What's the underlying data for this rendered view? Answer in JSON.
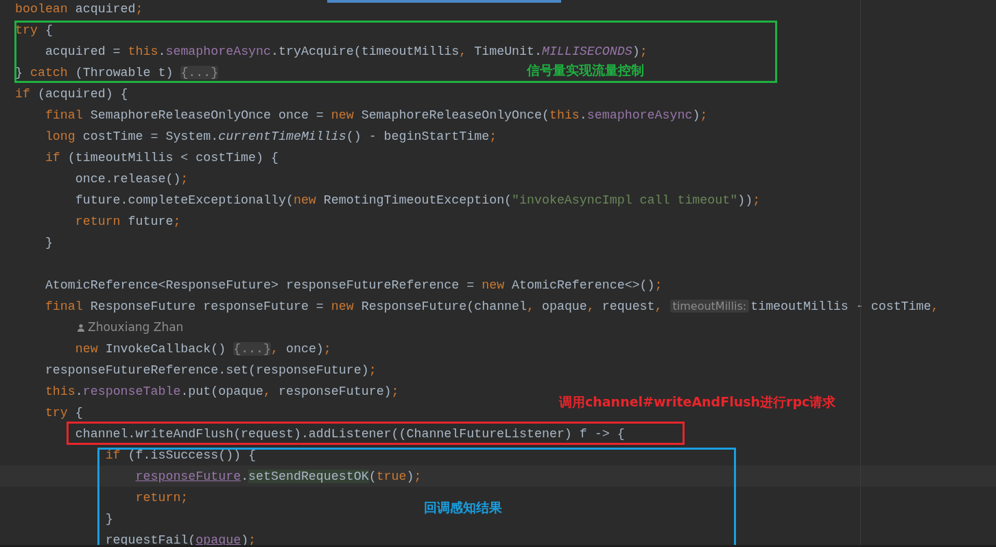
{
  "editor": {
    "lines": [
      {
        "kind": "code",
        "tokens": [
          {
            "kind": "k",
            "text": "boolean"
          },
          {
            "kind": "p",
            "text": " acquired"
          },
          {
            "kind": "k",
            "text": ";"
          }
        ]
      },
      {
        "kind": "code",
        "tokens": [
          {
            "kind": "k",
            "text": "try"
          },
          {
            "kind": "p",
            "text": " {"
          }
        ]
      },
      {
        "kind": "code",
        "tokens": [
          {
            "kind": "p",
            "text": "    acquired = "
          },
          {
            "kind": "k",
            "text": "this"
          },
          {
            "kind": "p",
            "text": "."
          },
          {
            "kind": "f",
            "text": "semaphoreAsync"
          },
          {
            "kind": "p",
            "text": ".tryAcquire(timeoutMillis"
          },
          {
            "kind": "k",
            "text": ","
          },
          {
            "kind": "p",
            "text": " TimeUnit."
          },
          {
            "kind": "c",
            "text": "MILLISECONDS"
          },
          {
            "kind": "p",
            "text": ")"
          },
          {
            "kind": "k",
            "text": ";"
          }
        ]
      },
      {
        "kind": "code",
        "tokens": [
          {
            "kind": "p",
            "text": "} "
          },
          {
            "kind": "k",
            "text": "catch"
          },
          {
            "kind": "p",
            "text": " (Throwable t) "
          },
          {
            "kind": "fold",
            "text": "{...}"
          }
        ]
      },
      {
        "kind": "code",
        "tokens": [
          {
            "kind": "k",
            "text": "if"
          },
          {
            "kind": "p",
            "text": " (acquired) {"
          }
        ]
      },
      {
        "kind": "code",
        "tokens": [
          {
            "kind": "k",
            "text": "    final"
          },
          {
            "kind": "p",
            "text": " SemaphoreReleaseOnlyOnce once = "
          },
          {
            "kind": "k",
            "text": "new"
          },
          {
            "kind": "p",
            "text": " SemaphoreReleaseOnlyOnce("
          },
          {
            "kind": "k",
            "text": "this"
          },
          {
            "kind": "p",
            "text": "."
          },
          {
            "kind": "f",
            "text": "semaphoreAsync"
          },
          {
            "kind": "p",
            "text": ")"
          },
          {
            "kind": "k",
            "text": ";"
          }
        ]
      },
      {
        "kind": "code",
        "tokens": [
          {
            "kind": "k",
            "text": "    long"
          },
          {
            "kind": "p",
            "text": " costTime = System."
          },
          {
            "kind": "i",
            "text": "currentTimeMillis"
          },
          {
            "kind": "p",
            "text": "() - beginStartTime"
          },
          {
            "kind": "k",
            "text": ";"
          }
        ]
      },
      {
        "kind": "code",
        "tokens": [
          {
            "kind": "k",
            "text": "    if"
          },
          {
            "kind": "p",
            "text": " (timeoutMillis < costTime) {"
          }
        ]
      },
      {
        "kind": "code",
        "tokens": [
          {
            "kind": "p",
            "text": "        once.release()"
          },
          {
            "kind": "k",
            "text": ";"
          }
        ]
      },
      {
        "kind": "code",
        "tokens": [
          {
            "kind": "p",
            "text": "        future.completeExceptionally("
          },
          {
            "kind": "k",
            "text": "new"
          },
          {
            "kind": "p",
            "text": " RemotingTimeoutException("
          },
          {
            "kind": "s",
            "text": "\"invokeAsyncImpl call timeout\""
          },
          {
            "kind": "p",
            "text": "))"
          },
          {
            "kind": "k",
            "text": ";"
          }
        ]
      },
      {
        "kind": "code",
        "tokens": [
          {
            "kind": "k",
            "text": "        return"
          },
          {
            "kind": "p",
            "text": " future"
          },
          {
            "kind": "k",
            "text": ";"
          }
        ]
      },
      {
        "kind": "code",
        "tokens": [
          {
            "kind": "p",
            "text": "    }"
          }
        ]
      },
      {
        "kind": "blank"
      },
      {
        "kind": "code",
        "tokens": [
          {
            "kind": "p",
            "text": "    AtomicReference<ResponseFuture> responseFutureReference = "
          },
          {
            "kind": "k",
            "text": "new"
          },
          {
            "kind": "p",
            "text": " AtomicReference<>()"
          },
          {
            "kind": "k",
            "text": ";"
          }
        ]
      },
      {
        "kind": "code",
        "tokens": [
          {
            "kind": "k",
            "text": "    final"
          },
          {
            "kind": "p",
            "text": " ResponseFuture responseFuture = "
          },
          {
            "kind": "k",
            "text": "new"
          },
          {
            "kind": "p",
            "text": " ResponseFuture(channel"
          },
          {
            "kind": "k",
            "text": ","
          },
          {
            "kind": "p",
            "text": " opaque"
          },
          {
            "kind": "k",
            "text": ","
          },
          {
            "kind": "p",
            "text": " request"
          },
          {
            "kind": "k",
            "text": ", "
          },
          {
            "kind": "hint",
            "text": "timeoutMillis:"
          },
          {
            "kind": "p",
            "text": "timeoutMillis - costTime"
          },
          {
            "kind": "k",
            "text": ","
          }
        ]
      },
      {
        "kind": "author",
        "text": "Zhouxiang Zhan"
      },
      {
        "kind": "code",
        "tokens": [
          {
            "kind": "k",
            "text": "        new"
          },
          {
            "kind": "p",
            "text": " InvokeCallback() "
          },
          {
            "kind": "fold",
            "text": "{...}"
          },
          {
            "kind": "k",
            "text": ","
          },
          {
            "kind": "p",
            "text": " once)"
          },
          {
            "kind": "k",
            "text": ";"
          }
        ]
      },
      {
        "kind": "code",
        "tokens": [
          {
            "kind": "p",
            "text": "    responseFutureReference.set(responseFuture)"
          },
          {
            "kind": "k",
            "text": ";"
          }
        ]
      },
      {
        "kind": "code",
        "tokens": [
          {
            "kind": "k",
            "text": "    this"
          },
          {
            "kind": "p",
            "text": "."
          },
          {
            "kind": "f",
            "text": "responseTable"
          },
          {
            "kind": "p",
            "text": ".put(opaque"
          },
          {
            "kind": "k",
            "text": ","
          },
          {
            "kind": "p",
            "text": " responseFuture)"
          },
          {
            "kind": "k",
            "text": ";"
          }
        ]
      },
      {
        "kind": "code",
        "tokens": [
          {
            "kind": "k",
            "text": "    try"
          },
          {
            "kind": "p",
            "text": " {"
          }
        ]
      },
      {
        "kind": "code",
        "tokens": [
          {
            "kind": "p",
            "text": "        channel.writeAndFlush(request).addListener((ChannelFutureListener) f -> {"
          }
        ]
      },
      {
        "kind": "code",
        "tokens": [
          {
            "kind": "k",
            "text": "            if"
          },
          {
            "kind": "p",
            "text": " (f.isSuccess()) {"
          }
        ]
      },
      {
        "kind": "code",
        "current": true,
        "tokens": [
          {
            "kind": "u",
            "text": "                responseFuture"
          },
          {
            "kind": "p",
            "text": "."
          },
          {
            "kind": "hl",
            "text": "setSendRequestOK"
          },
          {
            "kind": "p",
            "text": "("
          },
          {
            "kind": "k",
            "text": "true"
          },
          {
            "kind": "p",
            "text": ")"
          },
          {
            "kind": "k",
            "text": ";"
          }
        ]
      },
      {
        "kind": "code",
        "tokens": [
          {
            "kind": "k",
            "text": "                return"
          },
          {
            "kind": "k",
            "text": ";"
          }
        ]
      },
      {
        "kind": "code",
        "tokens": [
          {
            "kind": "p",
            "text": "            }"
          }
        ]
      },
      {
        "kind": "code",
        "tokens": [
          {
            "kind": "p",
            "text": "            requestFail("
          },
          {
            "kind": "u",
            "text": "opaque"
          },
          {
            "kind": "p",
            "text": ")"
          },
          {
            "kind": "k",
            "text": ";"
          }
        ]
      }
    ]
  },
  "annotations": [
    {
      "label": "信号量实现流量控制",
      "color": "#1fb141"
    },
    {
      "label": "调用channel#writeAndFlush进行rpc请求",
      "color": "#e8252b"
    },
    {
      "label": "回调感知结果",
      "color": "#1a9fe0"
    }
  ]
}
